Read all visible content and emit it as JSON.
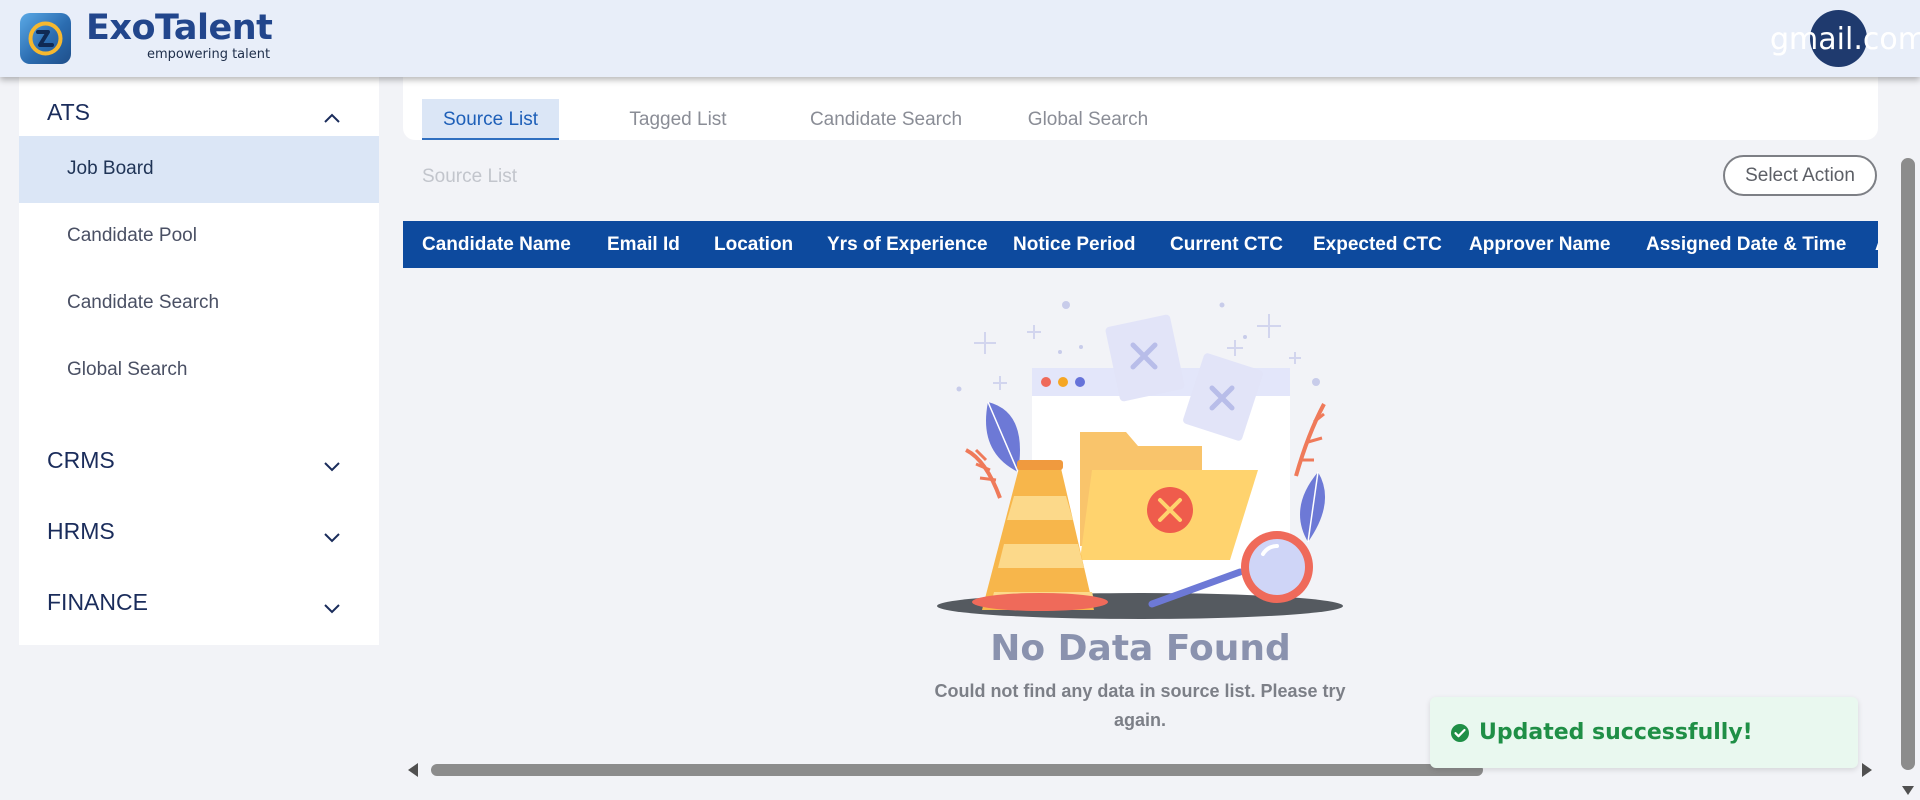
{
  "header": {
    "brand_title": "ExoTalent",
    "brand_tagline": "empowering talent",
    "user_email_fragment": "gmail.com"
  },
  "sidebar": {
    "sections": [
      {
        "label": "ATS",
        "expanded": true,
        "items": [
          {
            "label": "Job Board",
            "active": true
          },
          {
            "label": "Candidate Pool",
            "active": false
          },
          {
            "label": "Candidate Search",
            "active": false
          },
          {
            "label": "Global Search",
            "active": false
          }
        ]
      },
      {
        "label": "CRMS",
        "expanded": false
      },
      {
        "label": "HRMS",
        "expanded": false
      },
      {
        "label": "FINANCE",
        "expanded": false
      }
    ]
  },
  "tabs": [
    {
      "label": "Source List",
      "active": true
    },
    {
      "label": "Tagged List",
      "active": false
    },
    {
      "label": "Candidate Search",
      "active": false
    },
    {
      "label": "Global Search",
      "active": false
    }
  ],
  "list_title": "Source List",
  "select_action_label": "Select Action",
  "table": {
    "columns": [
      "Candidate Name",
      "Email Id",
      "Location",
      "Yrs of Experience",
      "Notice Period",
      "Current CTC",
      "Expected CTC",
      "Approver Name",
      "Assigned Date & Time"
    ]
  },
  "empty_state": {
    "title": "No Data Found",
    "description": "Could not find any data in source list. Please try again."
  },
  "toast": {
    "message": "Updated successfully!",
    "status_color": "#1f8f46"
  },
  "colors": {
    "brand": "#22468c",
    "table_header": "#0d4a9e",
    "active_bg": "#dbe6f6"
  }
}
